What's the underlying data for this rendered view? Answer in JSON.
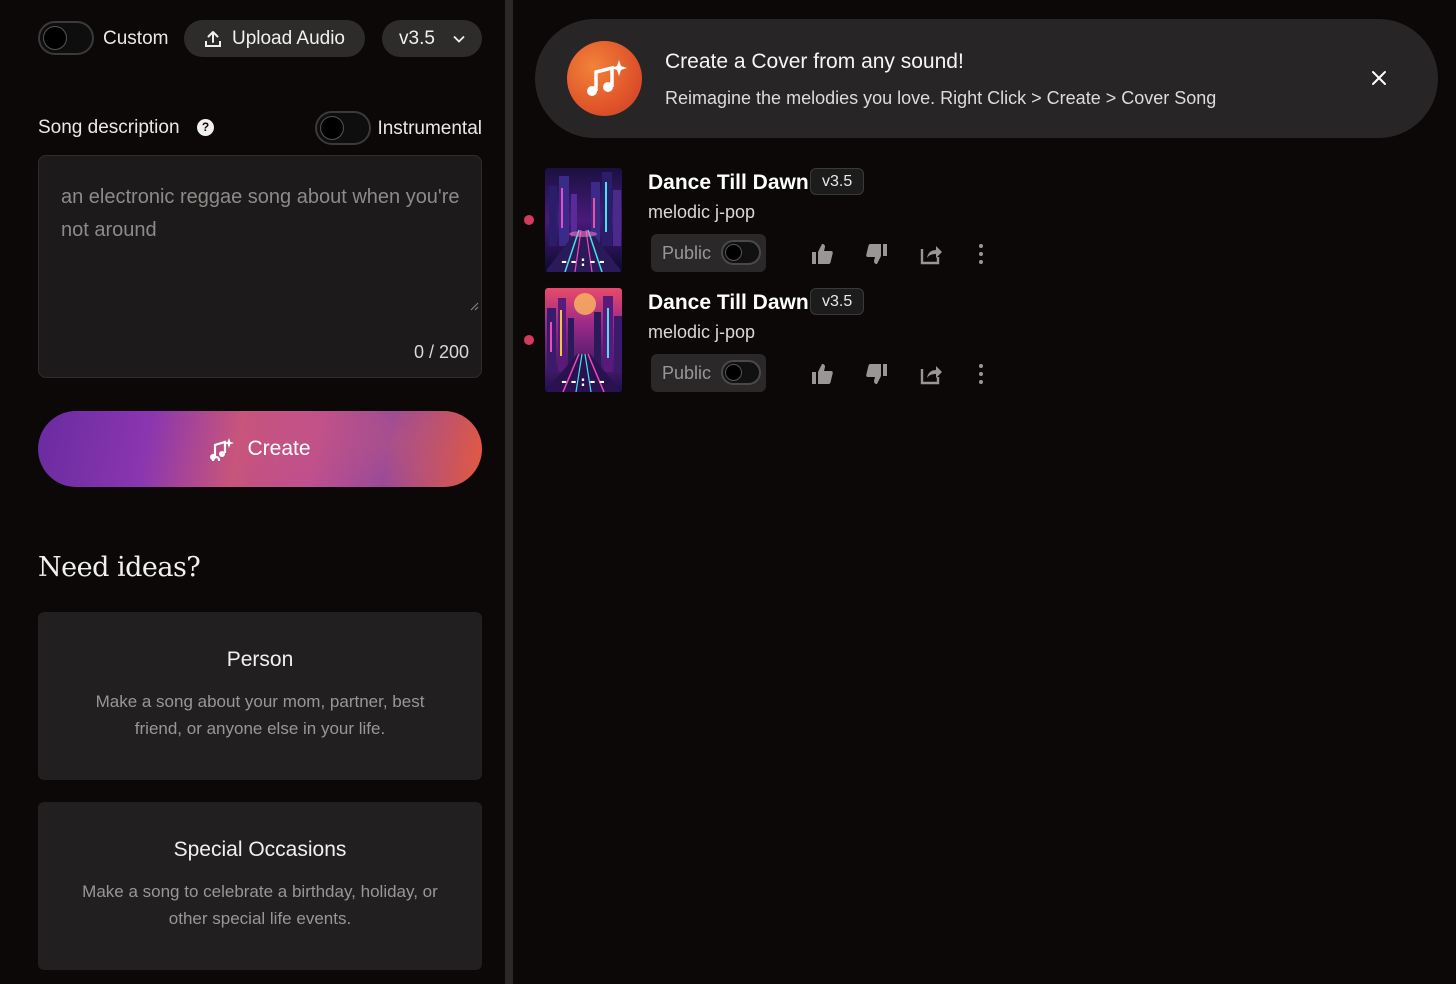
{
  "left": {
    "custom_label": "Custom",
    "upload_label": "Upload Audio",
    "version_label": "v3.5",
    "desc_label": "Song description",
    "instrumental_label": "Instrumental",
    "desc_placeholder": "an electronic reggae song about when you're not around",
    "char_count": "0 / 200",
    "create_label": "Create",
    "ideas_title": "Need ideas?",
    "ideas": [
      {
        "title": "Person",
        "desc": "Make a song about your mom, partner, best friend, or anyone else in your life."
      },
      {
        "title": "Special Occasions",
        "desc": "Make a song to celebrate a birthday, holiday, or other special life events."
      }
    ]
  },
  "banner": {
    "title": "Create a Cover from any sound!",
    "subtitle": "Reimagine the melodies you love. Right Click > Create > Cover Song"
  },
  "songs": [
    {
      "title": "Dance Till Dawn",
      "version": "v3.5",
      "genre": "melodic j-pop",
      "visibility": "Public",
      "duration": "--:--"
    },
    {
      "title": "Dance Till Dawn",
      "version": "v3.5",
      "genre": "melodic j-pop",
      "visibility": "Public",
      "duration": "--:--"
    }
  ],
  "colors": {
    "accent_dot": "#d6385e",
    "banner_icon": "#e0552a",
    "create_gradient_start": "#6a2ba0",
    "create_gradient_end": "#e2563a"
  },
  "icons": [
    "upload-icon",
    "chevron-down-icon",
    "help-icon",
    "music-sparkle-icon",
    "close-icon",
    "thumbs-up-icon",
    "thumbs-down-icon",
    "share-icon",
    "more-vertical-icon"
  ]
}
